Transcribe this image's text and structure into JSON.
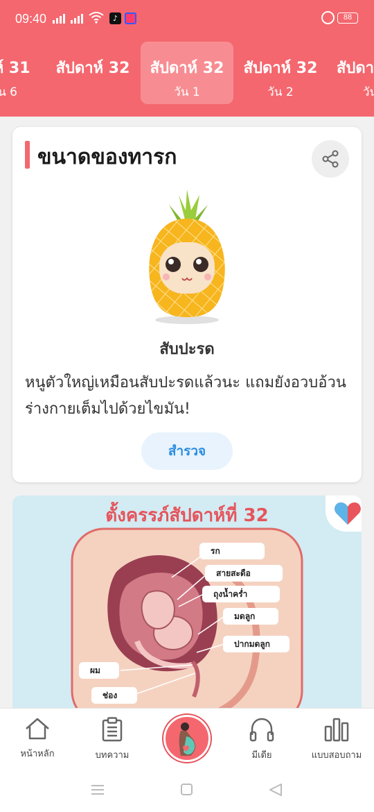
{
  "status_bar": {
    "time": "09:40",
    "battery": "88"
  },
  "week_tabs": [
    {
      "title": "าห์ 31",
      "day": "น 6"
    },
    {
      "title": "สัปดาห์ 32",
      "day": ""
    },
    {
      "title": "สัปดาห์ 32",
      "day": "วัน 1",
      "active": true
    },
    {
      "title": "สัปดาห์ 32",
      "day": "วัน 2"
    },
    {
      "title": "สัปดา",
      "day": "วัน"
    }
  ],
  "baby_size_card": {
    "title": "ขนาดของทารก",
    "fruit_name": "สับปะรด",
    "description": "หนูตัวใหญ่เหมือนสับปะรดแล้วนะ แถมยังอวบอ้วน ร่างกายเต็มไปด้วยไขมัน!",
    "explore_label": "สำรวจ"
  },
  "illustration": {
    "title": "ตั้งครรภ์สัปดาห์ที่ 32",
    "labels": [
      "รก",
      "สายสะดือ",
      "ถุงน้ำคร่ำ",
      "มดลูก",
      "ปากมดลูก",
      "ผม",
      "ช่องคลอด"
    ]
  },
  "bottom_nav": {
    "home": "หน้าหลัก",
    "articles": "บทความ",
    "media": "มีเดีย",
    "survey": "แบบสอบถาม"
  },
  "colors": {
    "brand": "#f4676e",
    "accent_blue": "#2b8de0"
  }
}
